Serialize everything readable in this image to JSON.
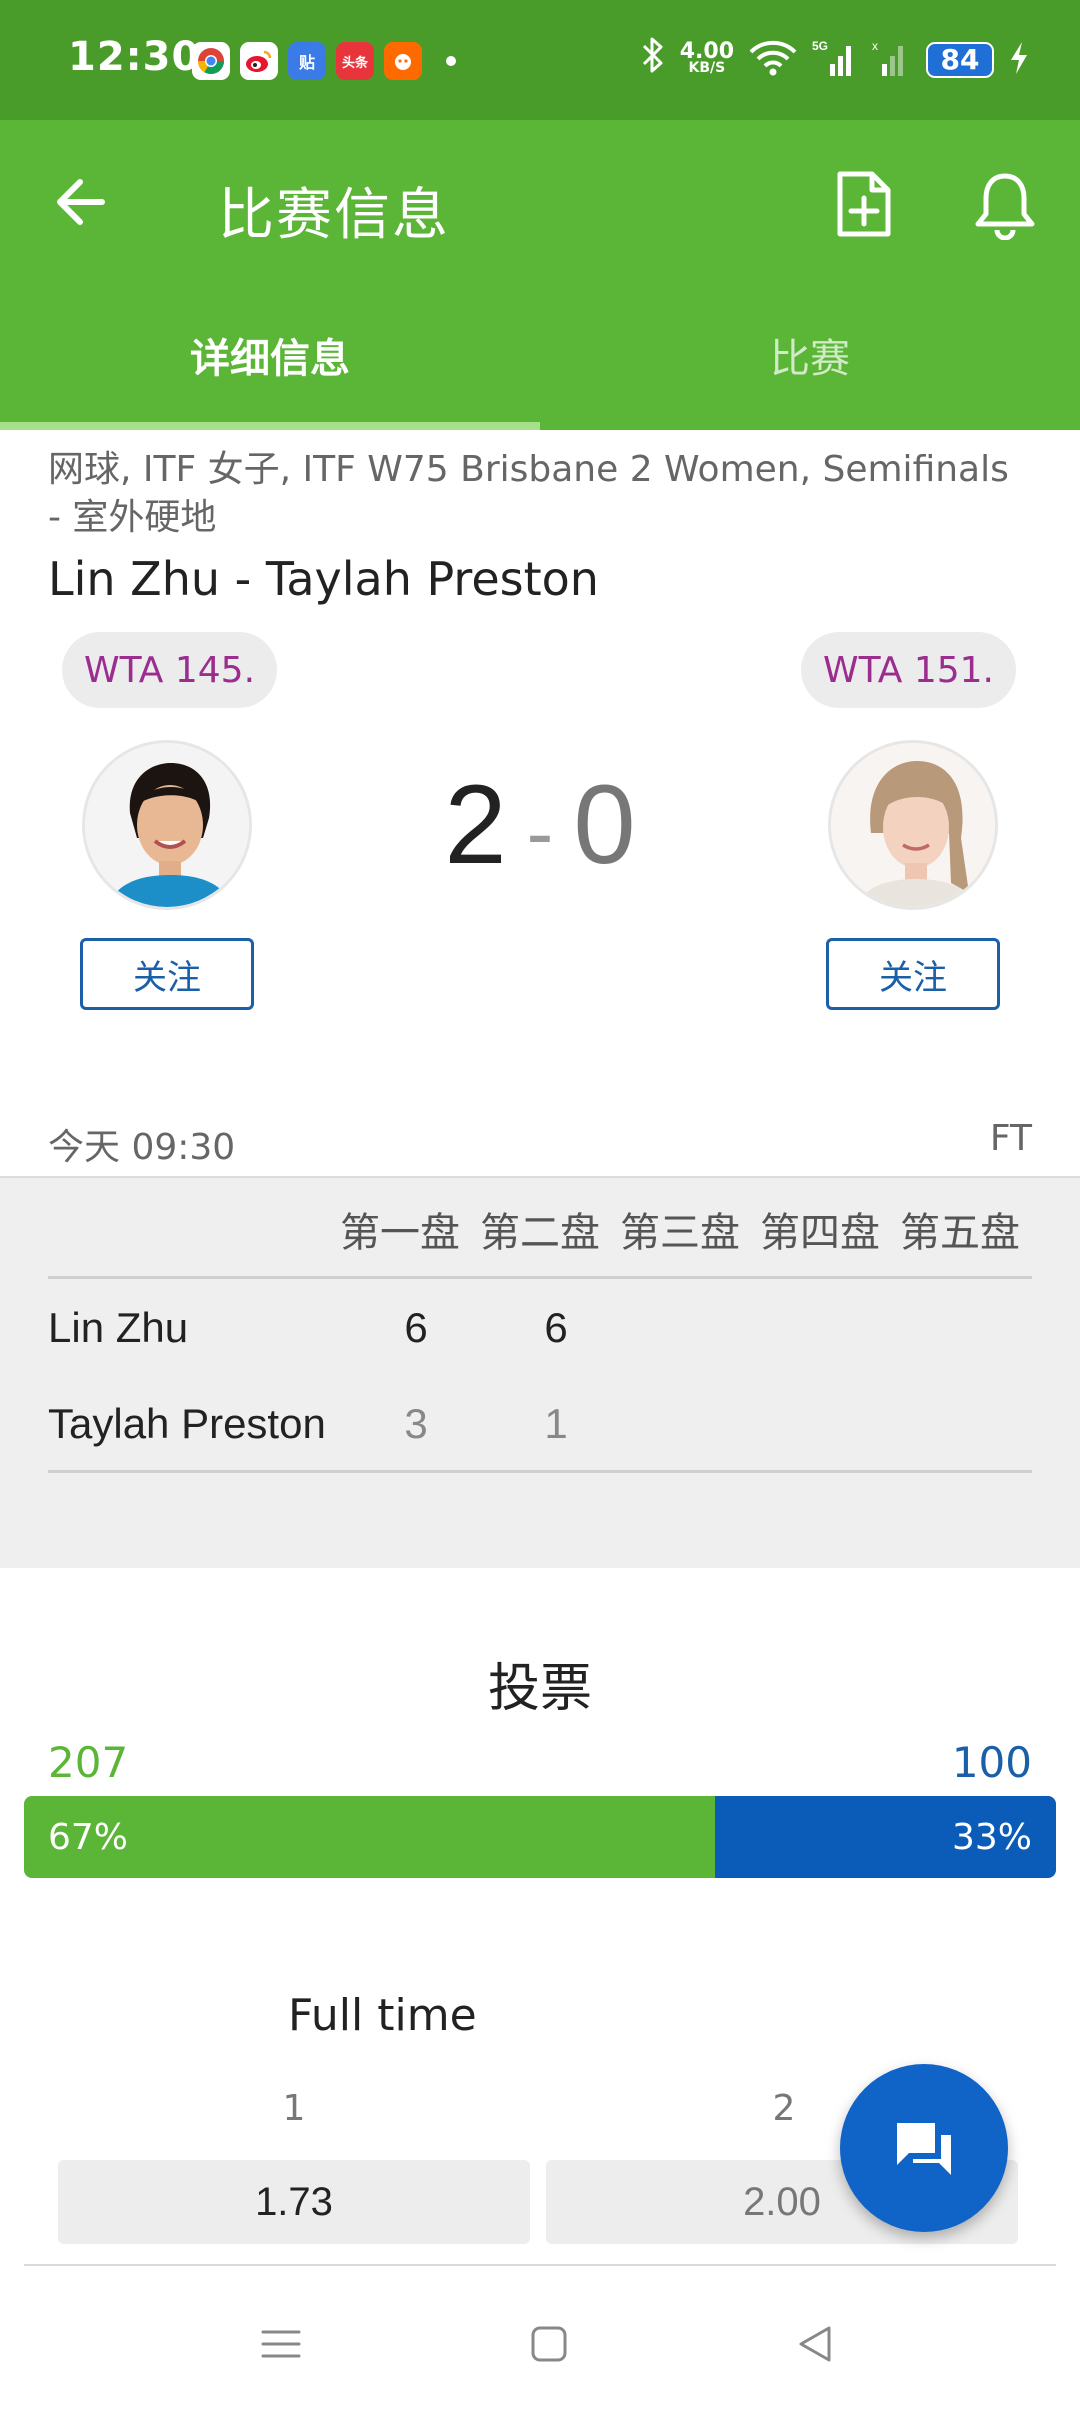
{
  "status_bar": {
    "time": "12:30",
    "speed_top": "4.00",
    "speed_bottom": "KB/S",
    "battery": "84",
    "app_icons": [
      "chrome-icon",
      "weibo-icon",
      "tieba-icon",
      "toutiao-icon",
      "taobao-icon"
    ]
  },
  "appbar": {
    "title": "比赛信息",
    "back_icon": "arrow-left-icon",
    "doc_icon": "document-add-icon",
    "bell_icon": "bell-icon"
  },
  "tabs": [
    {
      "label": "详细信息",
      "active": true
    },
    {
      "label": "比赛",
      "active": false
    }
  ],
  "match": {
    "subtitle": "网球, ITF 女子, ITF W75 Brisbane 2 Women, Semifinals - 室外硬地",
    "title": "Lin Zhu - Taylah Preston",
    "home_rank": "WTA 145.",
    "away_rank": "WTA 151.",
    "home_score": "2",
    "away_score": "0",
    "separator": "-",
    "follow_label": "关注",
    "time": "今天 09:30",
    "status": "FT"
  },
  "sets": {
    "headers": [
      "第一盘",
      "第二盘",
      "第三盘",
      "第四盘",
      "第五盘"
    ],
    "rows": [
      {
        "name": "Lin Zhu",
        "scores": [
          "6",
          "6"
        ]
      },
      {
        "name": "Taylah Preston",
        "scores": [
          "3",
          "1"
        ]
      }
    ]
  },
  "votes": {
    "title": "投票",
    "home_count": "207",
    "away_count": "100",
    "home_pct": "67%",
    "away_pct": "33%",
    "home_fraction": 0.67,
    "home_color": "#5bb537",
    "away_color": "#0a5cb8"
  },
  "odds": {
    "title": "Full time",
    "label_1": "1",
    "label_2": "2",
    "value_1": "1.73",
    "value_2": "2.00"
  },
  "colors": {
    "accent_green": "#5bb537",
    "status_green": "#4a9c2a",
    "accent_blue": "#1a5fa8",
    "rank_purple": "#9b2d8f"
  }
}
